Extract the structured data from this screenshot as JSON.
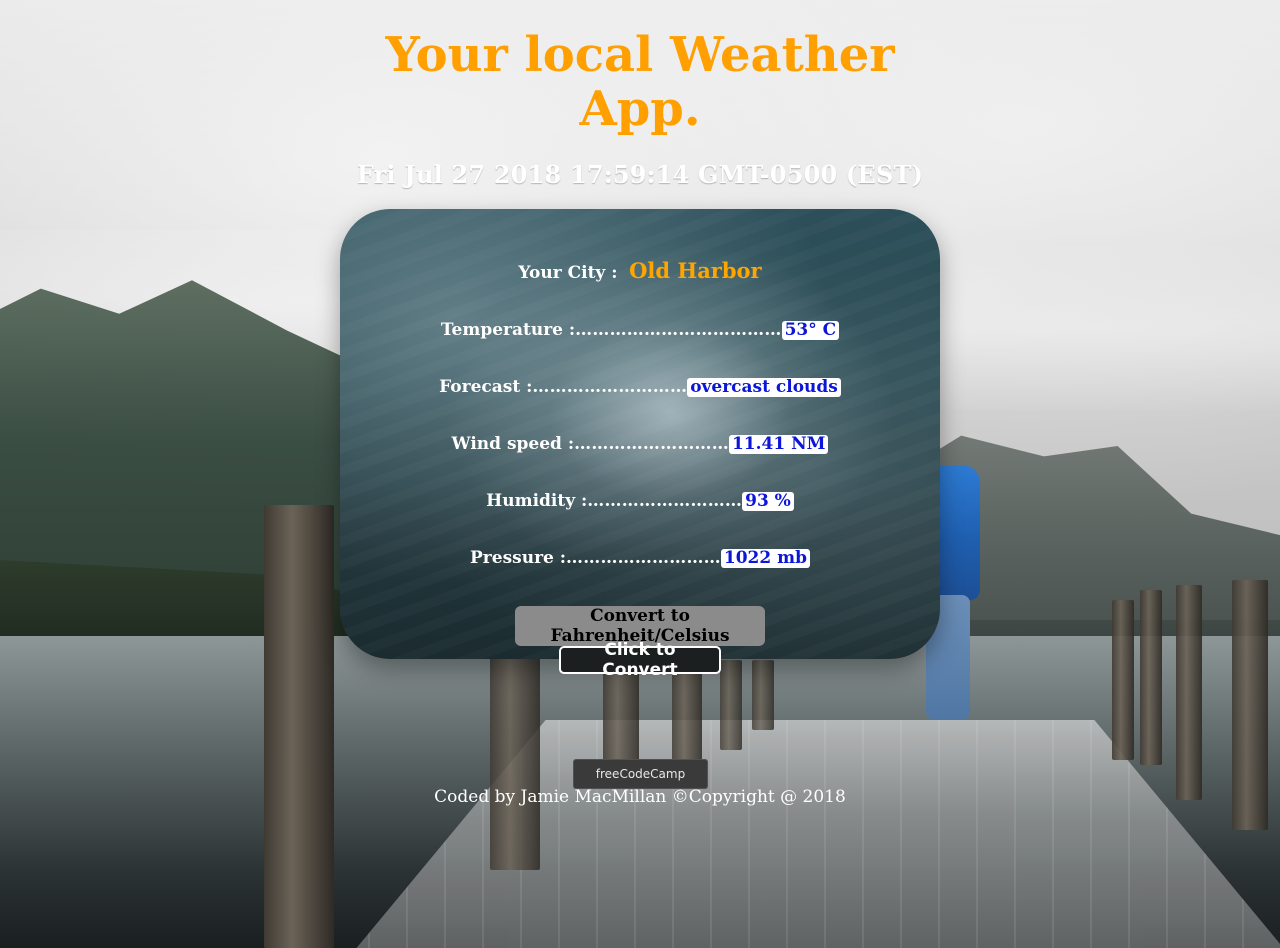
{
  "header": {
    "title_line1": "Your local Weather",
    "title_line2": "App.",
    "datetime": "Fri Jul 27 2018 17:59:14 GMT-0500 (EST)"
  },
  "weather": {
    "city_label": "Your City :",
    "city_value": "Old Harbor",
    "rows": [
      {
        "label": "Temperature :",
        "dots": "………………………………",
        "value": "53° C"
      },
      {
        "label": "Forecast :",
        "dots": "………………………",
        "value": "overcast clouds"
      },
      {
        "label": "Wind speed :",
        "dots": "………………………",
        "value": "11.41 NM"
      },
      {
        "label": "Humidity :",
        "dots": "………………………",
        "value": "93 %"
      },
      {
        "label": "Pressure :",
        "dots": "………………………",
        "value": "1022 mb"
      }
    ]
  },
  "actions": {
    "convert_heading_line1": "Convert to",
    "convert_heading_line2": "Fahrenheit/Celsius",
    "convert_button_label": "Click to Convert"
  },
  "footer": {
    "fcc_button_label": "freeCodeCamp",
    "credit": "Coded by Jamie MacMillan ©Copyright @ 2018"
  },
  "colors": {
    "title": "#ff9f00",
    "city": "#ffa500",
    "value_text": "#0b16d6",
    "value_bg": "#ffffff"
  }
}
